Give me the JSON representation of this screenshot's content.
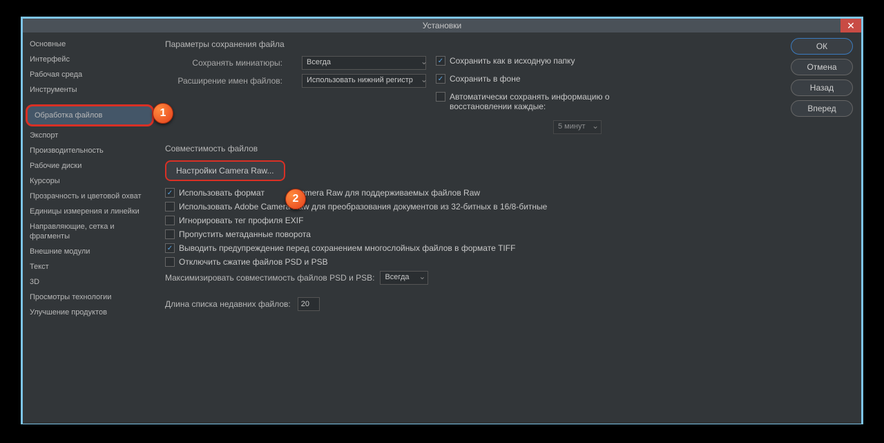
{
  "title": "Установки",
  "sidebar": [
    "Основные",
    "Интерфейс",
    "Рабочая среда",
    "Инструменты",
    "",
    "Обработка файлов",
    "Экспорт",
    "Производительность",
    "Рабочие диски",
    "Курсоры",
    "Прозрачность и цветовой охват",
    "Единицы измерения и линейки",
    "Направляющие, сетка и фрагменты",
    "Внешние модули",
    "Текст",
    "3D",
    "Просмотры технологии",
    "Улучшение продуктов"
  ],
  "buttons": {
    "ok": "ОК",
    "cancel": "Отмена",
    "back": "Назад",
    "forward": "Вперед"
  },
  "saveSection": {
    "title": "Параметры сохранения файла",
    "thumbLabel": "Сохранять миниатюры:",
    "thumbValue": "Всегда",
    "extLabel": "Расширение имен файлов:",
    "extValue": "Использовать нижний регистр",
    "saveOriginal": "Сохранить как в исходную папку",
    "saveBackground": "Сохранить в фоне",
    "autoSave": "Автоматически сохранять информацию о восстановлении каждые:",
    "autoInterval": "5 минут"
  },
  "compatSection": {
    "title": "Совместимость файлов",
    "cameraRawBtn": "Настройки Camera Raw...",
    "useCameraRaw": "Использовать формат             Camera Raw для поддерживаемых файлов Raw",
    "useAdobeCameraRaw": "Использовать Adobe Camera Raw для преобразования документов из 32-битных в 16/8-битные",
    "ignoreExif": "Игнорировать тег профиля EXIF",
    "skipRotate": "Пропустить метаданные поворота",
    "warnTiff": "Выводить предупреждение перед сохранением многослойных файлов в формате TIFF",
    "disablePsd": "Отключить сжатие файлов PSD и PSB",
    "maxCompatLabel": "Максимизировать совместимость файлов PSD и PSB:",
    "maxCompatValue": "Всегда"
  },
  "recentLabel": "Длина списка недавних файлов:",
  "recentValue": "20",
  "markers": {
    "one": "1",
    "two": "2"
  }
}
